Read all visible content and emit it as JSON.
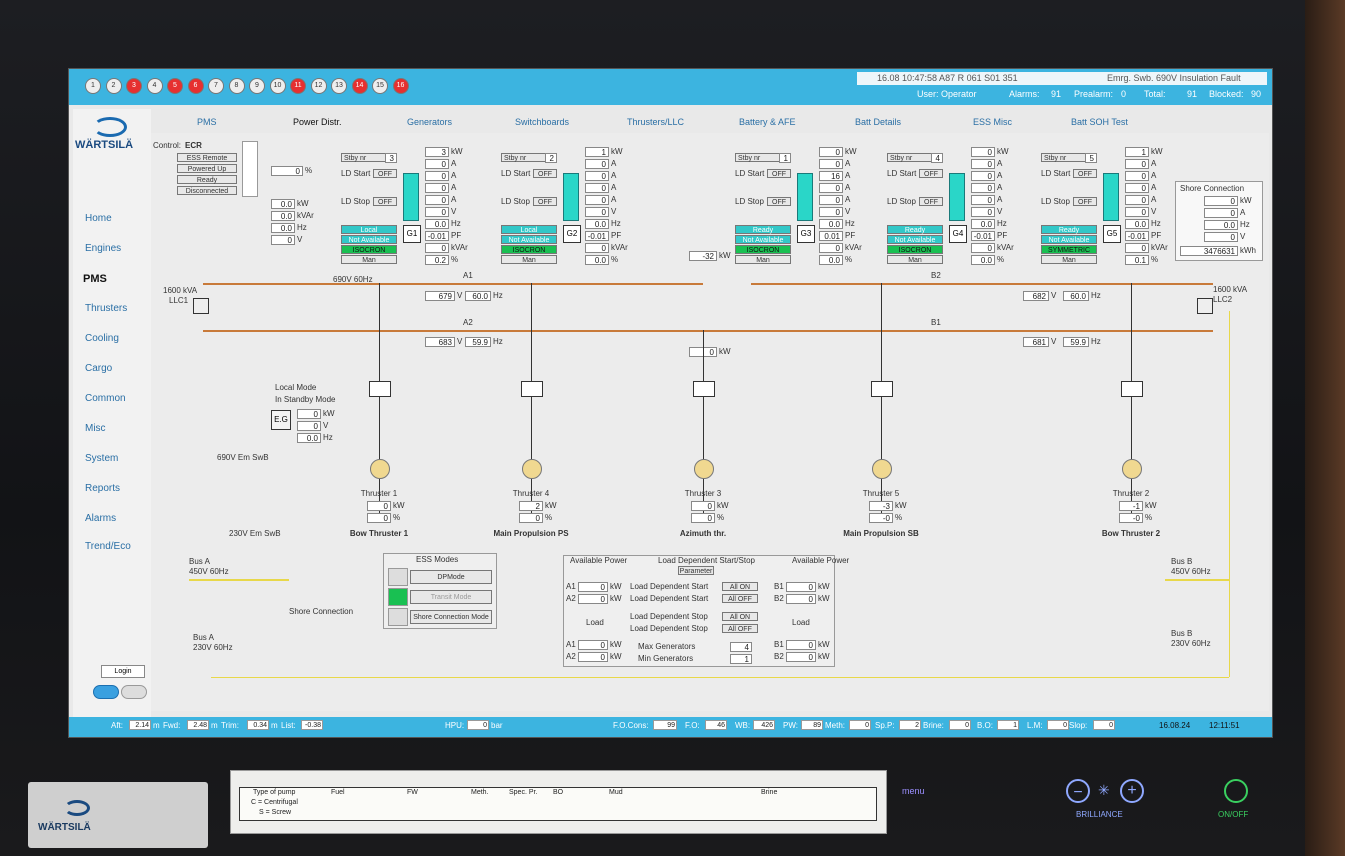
{
  "alarm_numbers": [
    {
      "n": "1",
      "red": false
    },
    {
      "n": "2",
      "red": false
    },
    {
      "n": "3",
      "red": true
    },
    {
      "n": "4",
      "red": false
    },
    {
      "n": "5",
      "red": true
    },
    {
      "n": "6",
      "red": true
    },
    {
      "n": "7",
      "red": false
    },
    {
      "n": "8",
      "red": false
    },
    {
      "n": "9",
      "red": false
    },
    {
      "n": "10",
      "red": false
    },
    {
      "n": "11",
      "red": true
    },
    {
      "n": "12",
      "red": false
    },
    {
      "n": "13",
      "red": false
    },
    {
      "n": "14",
      "red": true
    },
    {
      "n": "15",
      "red": false
    },
    {
      "n": "16",
      "red": true
    }
  ],
  "header": {
    "alarm_time": "16.08 10:47:58 A87 R 061 S01 351",
    "alarm_text": "Emrg. Swb. 690V Insulation Fault",
    "user_label": "User: Operator",
    "alarms_label": "Alarms:",
    "alarms_val": "91",
    "prealarm_label": "Prealarm:",
    "prealarm_val": "0",
    "total_label": "Total:",
    "total_val": "91",
    "blocked_label": "Blocked:",
    "blocked_val": "90"
  },
  "sidebar": {
    "brand": "WÄRTSILÄ",
    "items": [
      "Home",
      "Engines",
      "PMS",
      "Thrusters",
      "Cooling",
      "Cargo",
      "Common",
      "Misc",
      "System",
      "Reports",
      "Alarms",
      "Trend/Eco"
    ],
    "active": "PMS",
    "login": "Login"
  },
  "tabs": [
    "PMS",
    "Power Distr.",
    "Generators",
    "Switchboards",
    "Thrusters/LLC",
    "Battery & AFE",
    "Batt Details",
    "ESS Misc",
    "Batt SOH Test"
  ],
  "control": {
    "label": "Control:",
    "value": "ECR",
    "modes": [
      "ESS Remote",
      "Powered Up",
      "Ready",
      "Disconnected"
    ],
    "percent": "0",
    "kw": "0.0",
    "kvar": "0.0",
    "hz": "0.0",
    "v": "0"
  },
  "generators": [
    {
      "name": "G1",
      "stby": "Stby nr",
      "stby_nr": "3",
      "kw": "3",
      "a": "0",
      "a2": "0",
      "a3": "0",
      "a4": "0",
      "v": "0",
      "hz": "0.0",
      "pf": "-0.01",
      "kvar": "0",
      "pct": "0.2",
      "mode1": "Local",
      "mode2": "Not Available",
      "gov": "ISOCRON",
      "man": "Man",
      "ld_start": "OFF",
      "ld_stop": "OFF"
    },
    {
      "name": "G2",
      "stby": "Stby nr",
      "stby_nr": "2",
      "kw": "1",
      "a": "0",
      "a2": "0",
      "a3": "0",
      "a4": "0",
      "v": "0",
      "hz": "0.0",
      "pf": "-0.01",
      "kvar": "0",
      "pct": "0.0",
      "mode1": "Local",
      "mode2": "Not Available",
      "gov": "ISOCRON",
      "man": "Man",
      "ld_start": "OFF",
      "ld_stop": "OFF"
    },
    {
      "name": "G3",
      "stby": "Stby nr",
      "stby_nr": "1",
      "kw": "0",
      "a": "0",
      "a2": "16",
      "a3": "0",
      "a4": "0",
      "v": "0",
      "hz": "0.0",
      "pf": "0.01",
      "kvar": "0",
      "pct": "0.0",
      "mode1": "Ready",
      "mode2": "Not Available",
      "gov": "ISOCRON",
      "man": "Man",
      "ld_start": "OFF",
      "ld_stop": "OFF"
    },
    {
      "name": "G4",
      "stby": "Stby nr",
      "stby_nr": "4",
      "kw": "0",
      "a": "0",
      "a2": "0",
      "a3": "0",
      "a4": "0",
      "v": "0",
      "hz": "0.0",
      "pf": "-0.01",
      "kvar": "0",
      "pct": "0.0",
      "mode1": "Ready",
      "mode2": "Not Available",
      "gov": "ISOCRON",
      "man": "Man",
      "ld_start": "OFF",
      "ld_stop": "OFF"
    },
    {
      "name": "G5",
      "stby": "Stby nr",
      "stby_nr": "5",
      "kw": "1",
      "a": "0",
      "a2": "0",
      "a3": "0",
      "a4": "0",
      "v": "0",
      "hz": "0.0",
      "pf": "-0.01",
      "kvar": "0",
      "pct": "0.1",
      "mode1": "Ready",
      "mode2": "Not Available",
      "gov": "SYMMETRIC",
      "man": "Man",
      "ld_start": "OFF",
      "ld_stop": "OFF"
    }
  ],
  "shore": {
    "title": "Shore Connection",
    "kw": "0",
    "a": "0",
    "hz": "0.0",
    "v": "0",
    "kwh": "3476631"
  },
  "bus": {
    "a1": "A1",
    "a2": "A2",
    "b1": "B1",
    "b2": "B2",
    "rating": "690V 60Hz",
    "a1_v": "679",
    "a1_hz": "60.0",
    "a2_v": "683",
    "a2_hz": "59.9",
    "b1_v": "681",
    "b1_hz": "59.9",
    "b2_v": "682",
    "b2_hz": "60.0",
    "tie_kw": "-32",
    "bus3_kw": "0",
    "llc1": "LLC1",
    "llc2": "LLC2",
    "llc_kva": "1600 kVA"
  },
  "emergency": {
    "local": "Local Mode",
    "standby": "In Standby Mode",
    "eg": "E.G",
    "kw": "0",
    "v": "0",
    "hz": "0.0",
    "swb690": "690V Em SwB",
    "swb230": "230V Em SwB"
  },
  "thrusters": [
    {
      "name": "Thruster 1",
      "kw": "0",
      "pct": "0",
      "label": "Bow Thruster 1"
    },
    {
      "name": "Thruster 4",
      "kw": "2",
      "pct": "0",
      "label": "Main Propulsion PS"
    },
    {
      "name": "Thruster 3",
      "kw": "0",
      "pct": "0",
      "label": "Azimuth thr."
    },
    {
      "name": "Thruster 5",
      "kw": "-3",
      "pct": "-0",
      "label": "Main Propulsion SB"
    },
    {
      "name": "Thruster 2",
      "kw": "-1",
      "pct": "-0",
      "label": "Bow Thruster 2"
    }
  ],
  "ess": {
    "title": "ESS Modes",
    "dp": "DPMode",
    "transit": "Transit Mode",
    "shore": "Shore Connection Mode"
  },
  "busses_low": {
    "busA": "Bus A",
    "busA_450": "450V 60Hz",
    "busA_230": "230V 60Hz",
    "busB": "Bus B",
    "busB_450": "450V 60Hz",
    "busB_230": "230V 60Hz",
    "shore": "Shore Connection"
  },
  "ld": {
    "avail": "Available Power",
    "title": "Load Dependent Start/Stop",
    "param": "Parameter",
    "rows": [
      "Load Dependent Start",
      "Load Dependent Start",
      "Load Dependent Stop",
      "Load Dependent Stop"
    ],
    "btns": [
      "All ON",
      "All OFF",
      "All ON",
      "All OFF"
    ],
    "a1": "0",
    "a2": "0",
    "b1": "0",
    "b2": "0",
    "load": "Load",
    "la1": "0",
    "la2": "0",
    "lb1": "0",
    "lb2": "0",
    "max_gen_label": "Max Generators",
    "max_gen": "4",
    "min_gen_label": "Min Generators",
    "min_gen": "1"
  },
  "bottom": {
    "aft": "2.14",
    "fwd": "2.48",
    "trim": "0.34",
    "list": "-0.38",
    "hpu": "0",
    "fo_cons": "99",
    "fo": "46",
    "wb": "426",
    "pw": "89",
    "meth": "0",
    "sp": "2",
    "brine": "0",
    "bo": "1",
    "lm": "0",
    "slop": "0",
    "date": "16.08.24",
    "time": "12:11:51"
  },
  "pump_table": {
    "title": "Type of pump",
    "c": "C = Centrifugal",
    "s": "S = Screw",
    "groups": [
      "Fuel",
      "FW",
      "Meth.",
      "Spec. Pr.",
      "BO",
      "Mud",
      "Brine"
    ]
  },
  "controls": {
    "menu": "menu",
    "brilliance": "BRILLIANCE",
    "onoff": "ON/OFF"
  }
}
